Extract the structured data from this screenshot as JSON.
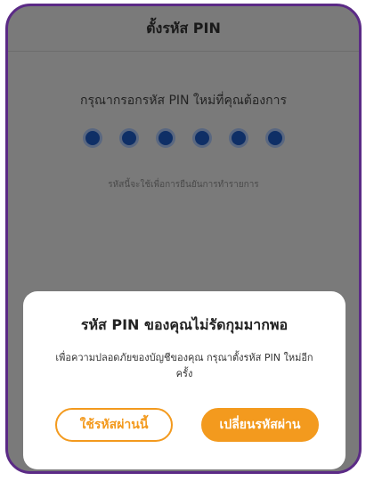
{
  "header": {
    "title": "ตั้งรหัส PIN"
  },
  "pin_entry": {
    "prompt": "กรุณากรอกรหัส PIN ใหม่ที่คุณต้องการ",
    "dot_count": 6,
    "hint": "รหัสนี้จะใช้เพื่อการยืนยันการทำรายการ"
  },
  "dialog": {
    "title": "รหัส PIN ของคุณไม่รัดกุมมากพอ",
    "message": "เพื่อความปลอดภัยของบัญชีของคุณ กรุณาตั้งรหัส PIN ใหม่อีกครั้ง",
    "keep_button": "ใช้รหัสผ่านนี้",
    "change_button": "เปลี่ยนรหัสผ่าน"
  },
  "colors": {
    "accent": "#f39a1e",
    "frame": "#5b2a86",
    "dot": "#0f2f66"
  }
}
